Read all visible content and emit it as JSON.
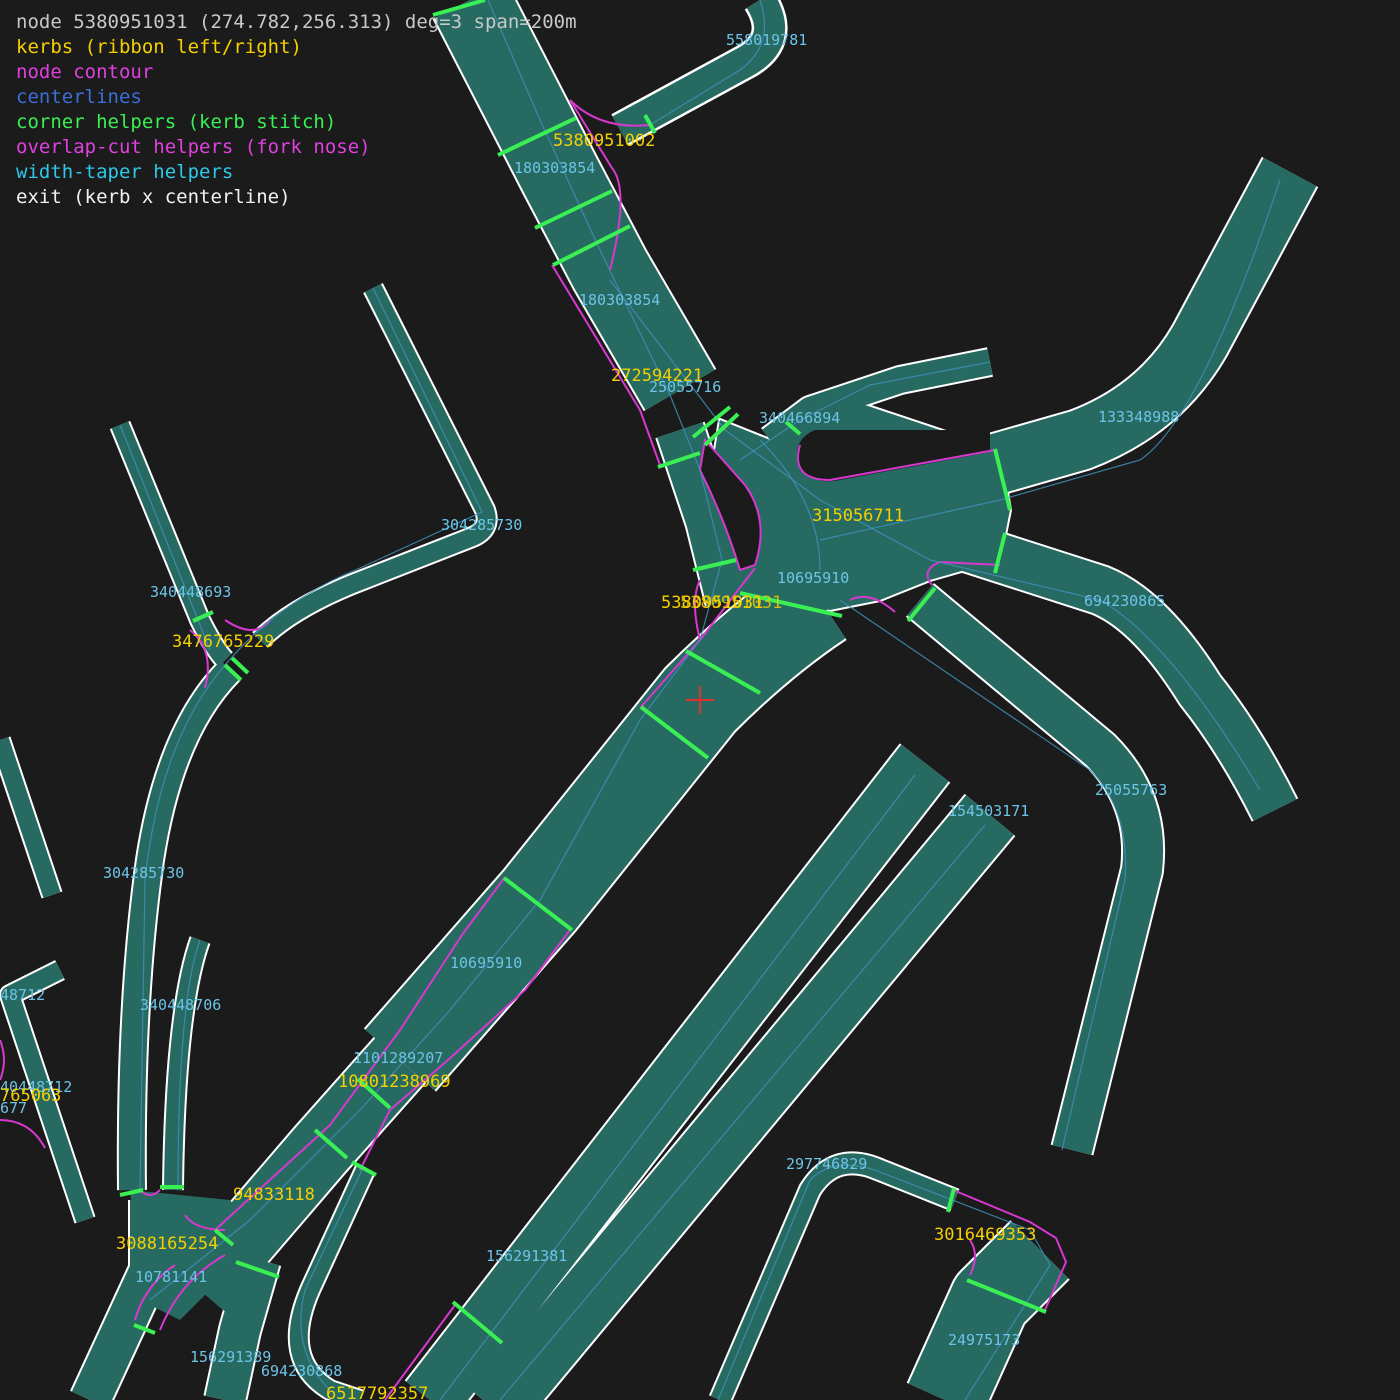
{
  "header": {
    "text": "node 5380951031 (274.782,256.313) deg=3 span=200m"
  },
  "legend": [
    {
      "label": "kerbs (ribbon left/right)",
      "color": "#f5d000"
    },
    {
      "label": "node contour",
      "color": "#e040e0"
    },
    {
      "label": "centerlines",
      "color": "#3b6fd8"
    },
    {
      "label": "corner helpers (kerb stitch)",
      "color": "#39ef54"
    },
    {
      "label": "overlap-cut helpers (fork nose)",
      "color": "#e040e0"
    },
    {
      "label": "width-taper helpers",
      "color": "#2ec8e8"
    },
    {
      "label": "exit (kerb x centerline)",
      "color": "#f2f2f2"
    }
  ],
  "way_labels": [
    "558019781",
    "180303854",
    "180303854",
    "25055716",
    "340466894",
    "133348988",
    "304285730",
    "340448693",
    "10695910",
    "694230865",
    "25055763",
    "154503171",
    "304285730",
    "10695910",
    "340448706",
    "1101289207",
    "48712",
    "40448712",
    "677",
    "297746829",
    "156291381",
    "10781141",
    "156291389",
    "694230868",
    "24975173"
  ],
  "node_labels": [
    "5380951002",
    "272594221",
    "315056711",
    "5380951031",
    "5380951031",
    "3476765229",
    "10801238969",
    "94833118",
    "3088165254",
    "765063",
    "3016469353",
    "6517792357"
  ],
  "colors": {
    "background": "#1b1b1b",
    "road": "#276a62",
    "kerb": "#ffffff"
  }
}
